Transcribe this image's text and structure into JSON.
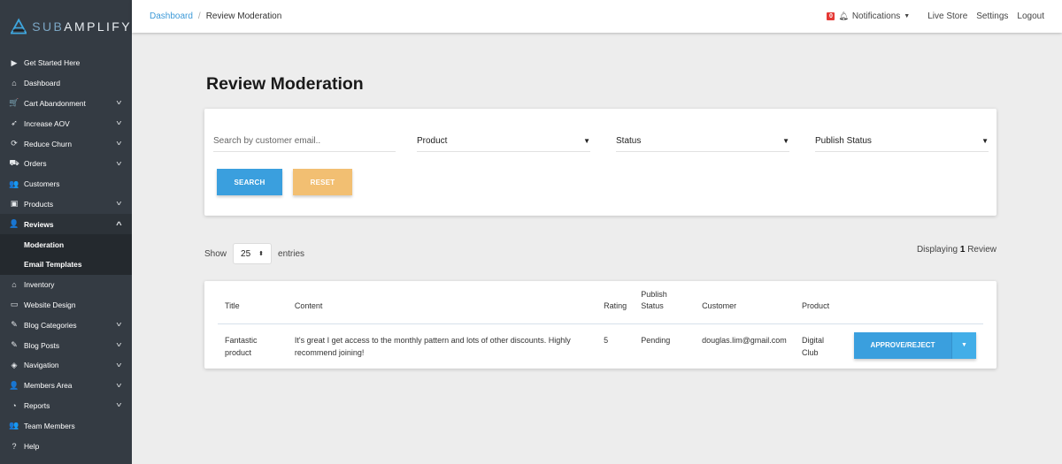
{
  "brand": {
    "sub": "SUB",
    "amplify": "AMPLIFY"
  },
  "sidebar": {
    "items": [
      {
        "label": "Get Started Here",
        "icon": "play-icon",
        "glyph": "▶",
        "has_chevron": false
      },
      {
        "label": "Dashboard",
        "icon": "home-icon",
        "glyph": "⌂",
        "has_chevron": false
      },
      {
        "label": "Cart Abandonment",
        "icon": "cart-icon",
        "glyph": "🛒",
        "has_chevron": true
      },
      {
        "label": "Increase AOV",
        "icon": "rocket-icon",
        "glyph": "➶",
        "has_chevron": true
      },
      {
        "label": "Reduce Churn",
        "icon": "refresh-icon",
        "glyph": "⟳",
        "has_chevron": true
      },
      {
        "label": "Orders",
        "icon": "truck-icon",
        "glyph": "⛟",
        "has_chevron": true
      },
      {
        "label": "Customers",
        "icon": "users-icon",
        "glyph": "👥",
        "has_chevron": false
      },
      {
        "label": "Products",
        "icon": "box-icon",
        "glyph": "▣",
        "has_chevron": true
      },
      {
        "label": "Reviews",
        "icon": "user-review-icon",
        "glyph": "👤",
        "has_chevron": true,
        "open": true,
        "children": [
          {
            "label": "Moderation"
          },
          {
            "label": "Email Templates"
          }
        ]
      },
      {
        "label": "Inventory",
        "icon": "warehouse-icon",
        "glyph": "⌂",
        "has_chevron": false
      },
      {
        "label": "Website Design",
        "icon": "desktop-icon",
        "glyph": "▭",
        "has_chevron": false
      },
      {
        "label": "Blog Categories",
        "icon": "blog-icon",
        "glyph": "✎",
        "has_chevron": true
      },
      {
        "label": "Blog Posts",
        "icon": "blog-icon",
        "glyph": "✎",
        "has_chevron": true
      },
      {
        "label": "Navigation",
        "icon": "compass-icon",
        "glyph": "◈",
        "has_chevron": true
      },
      {
        "label": "Members Area",
        "icon": "user-icon",
        "glyph": "👤",
        "has_chevron": true
      },
      {
        "label": "Reports",
        "icon": "pie-chart-icon",
        "glyph": "◔",
        "has_chevron": true
      },
      {
        "label": "Team Members",
        "icon": "team-icon",
        "glyph": "👥",
        "has_chevron": false
      },
      {
        "label": "Help",
        "icon": "question-icon",
        "glyph": "?",
        "has_chevron": false
      }
    ]
  },
  "topbar": {
    "breadcrumb": {
      "link": "Dashboard",
      "separator": "/",
      "current": "Review Moderation"
    },
    "notifications_count": "0",
    "notifications_label": "Notifications",
    "live_store": "Live Store",
    "settings": "Settings",
    "logout": "Logout"
  },
  "page": {
    "title": "Review Moderation"
  },
  "filters": {
    "search_placeholder": "Search by customer email..",
    "search_value": "",
    "product_label": "Product",
    "status_label": "Status",
    "publish_status_label": "Publish Status",
    "search_button": "SEARCH",
    "reset_button": "RESET"
  },
  "listing": {
    "show_label": "Show",
    "entries_value": "25",
    "entries_label": "entries",
    "displaying_prefix": "Displaying",
    "displaying_count": "1",
    "displaying_suffix": "Review"
  },
  "table": {
    "columns": [
      "Title",
      "Content",
      "Rating",
      "Publish Status",
      "Customer",
      "Product",
      ""
    ],
    "rows": [
      {
        "title": "Fantastic product",
        "content": "It's great I get access to the monthly pattern and lots of other discounts. Highly recommend joining!",
        "rating": "5",
        "publish_status": "Pending",
        "customer": "douglas.lim@gmail.com",
        "product": "Digital Club",
        "action_label": "APPROVE/REJECT"
      }
    ]
  },
  "colors": {
    "sidebar_bg": "#343b43",
    "primary": "#3a9fde",
    "warning": "#f2bf72",
    "link": "#3d9ad8",
    "badge": "#e53935"
  }
}
